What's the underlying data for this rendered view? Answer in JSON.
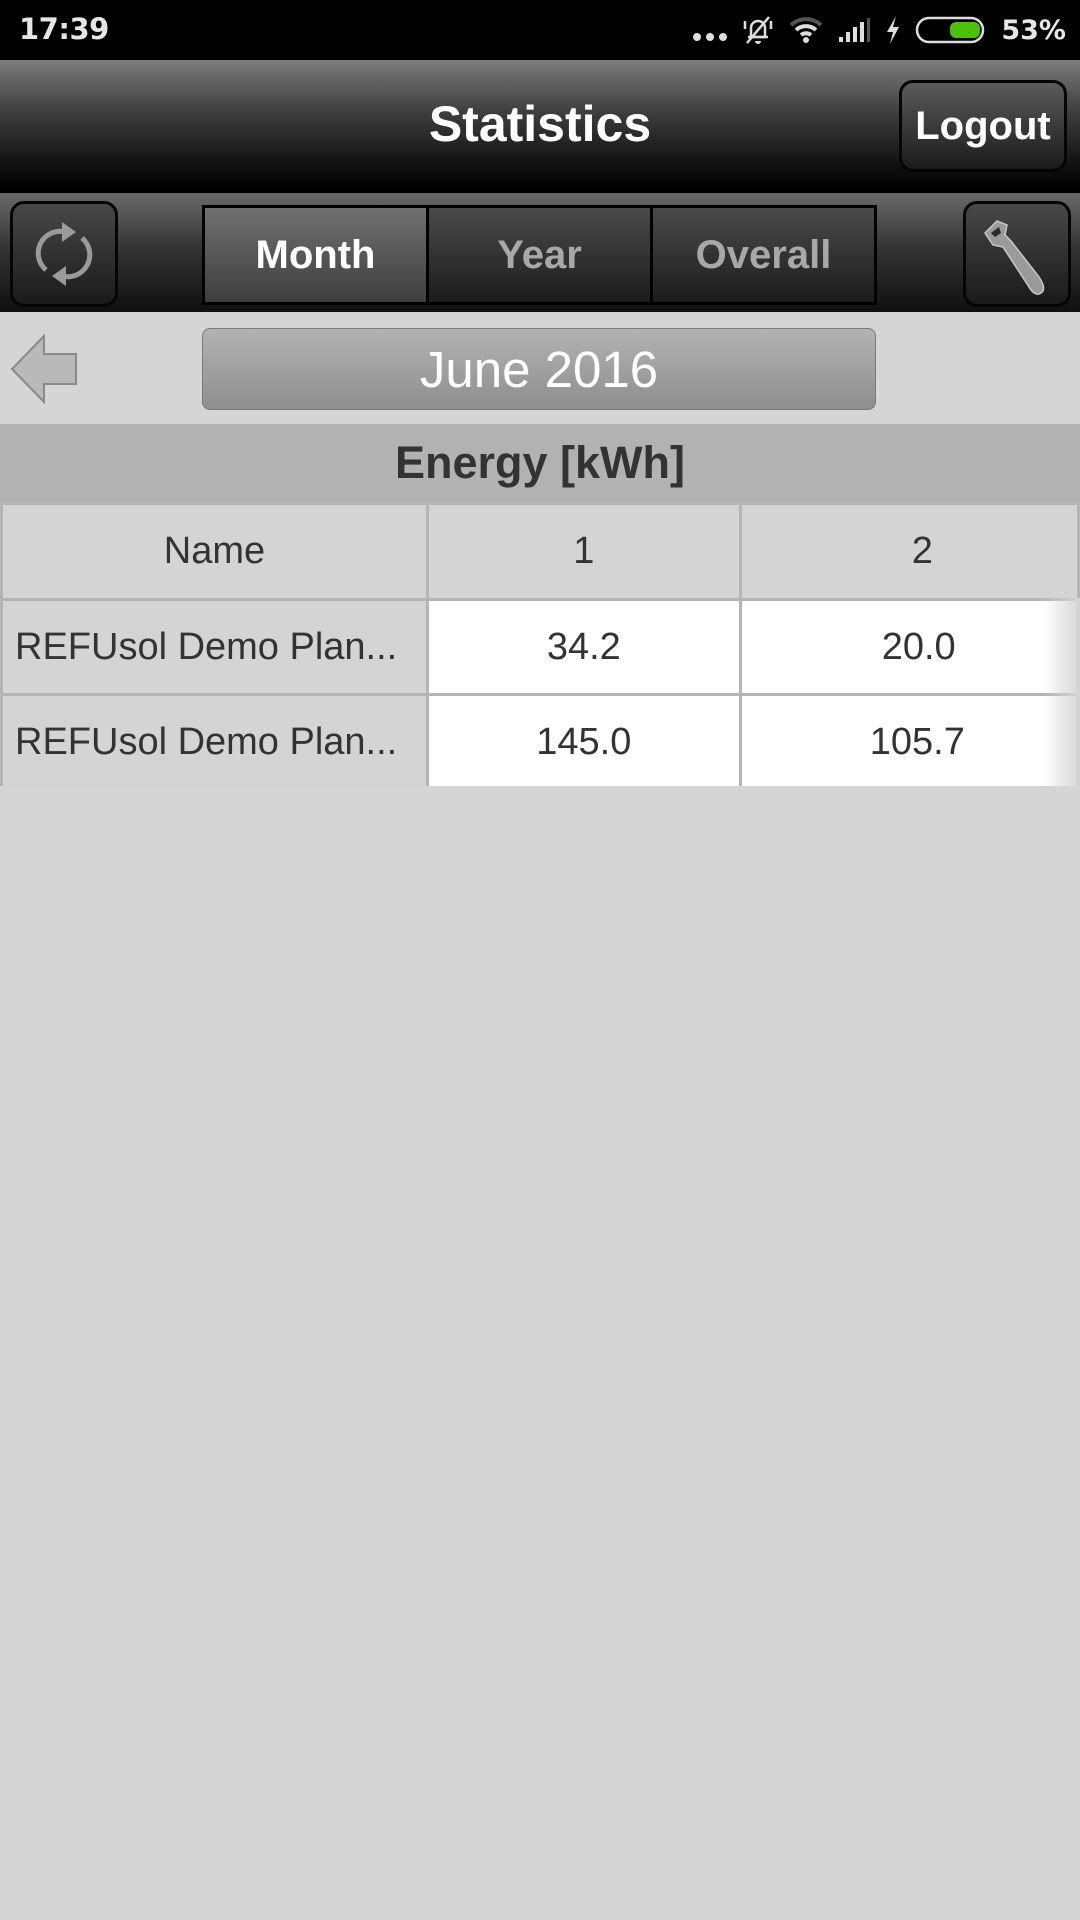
{
  "status_bar": {
    "time": "17:39",
    "icons": [
      "more-dots-icon",
      "bell-muted-icon",
      "wifi-icon",
      "cellular-signal-icon",
      "charging-icon",
      "battery-icon"
    ],
    "battery_percent": "53%",
    "battery_level": 0.53,
    "battery_color": "#4cc10a"
  },
  "header": {
    "title": "Statistics",
    "logout_label": "Logout"
  },
  "toolbar": {
    "refresh_icon": "refresh-icon",
    "settings_icon": "wrench-icon",
    "tabs": [
      {
        "label": "Month",
        "active": true
      },
      {
        "label": "Year",
        "active": false
      },
      {
        "label": "Overall",
        "active": false
      }
    ]
  },
  "period": {
    "back_icon": "arrow-left-icon",
    "label": "June 2016"
  },
  "section": {
    "title": "Energy [kWh]"
  },
  "table": {
    "columns": [
      "Name",
      "1",
      "2"
    ],
    "rows": [
      {
        "name": "REFUsol Demo Plan...",
        "values": [
          "34.2",
          "20.0"
        ]
      },
      {
        "name": "REFUsol Demo Plan...",
        "values": [
          "145.0",
          "105.7"
        ]
      }
    ]
  }
}
